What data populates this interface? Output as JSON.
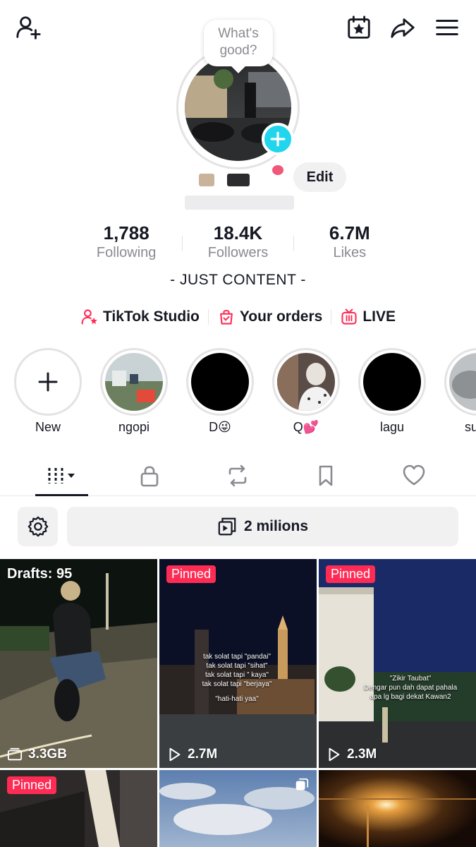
{
  "topbar": {
    "add_friend_icon": "person-plus-icon",
    "calendar_icon": "calendar-star-icon",
    "share_icon": "share-arrow-icon",
    "menu_icon": "hamburger-menu-icon"
  },
  "profile": {
    "bubble_line1": "What's",
    "bubble_line2": "good?",
    "edit_label": "Edit",
    "bio": "- JUST CONTENT -"
  },
  "stats": [
    {
      "value": "1,788",
      "label": "Following"
    },
    {
      "value": "18.4K",
      "label": "Followers"
    },
    {
      "value": "6.7M",
      "label": "Likes"
    }
  ],
  "links": [
    {
      "label": "TikTok Studio",
      "icon": "creator-star-icon"
    },
    {
      "label": "Your orders",
      "icon": "shopping-bag-icon"
    },
    {
      "label": "LIVE",
      "icon": "live-tv-icon"
    }
  ],
  "highlights": [
    {
      "label": "New"
    },
    {
      "label": "ngopi"
    },
    {
      "label": "D😜"
    },
    {
      "label": "Q💕"
    },
    {
      "label": "lagu"
    },
    {
      "label": "suns"
    }
  ],
  "tabs": [
    "videos-grid",
    "private-lock",
    "reposts",
    "favorites",
    "liked"
  ],
  "toolbar": {
    "collection_label": "2 milions"
  },
  "grid": [
    {
      "top_label": "Drafts: 95",
      "foot": "3.3GB"
    },
    {
      "badge": "Pinned",
      "foot": "2.7M",
      "lines": [
        "tak solat tapi \"pandai\"",
        "tak solat tapi \"sihat\"",
        "tak solat tapi \" kaya\"",
        "tak solat tapi \"berjaya\"",
        "",
        "\"hati-hati yaa\""
      ]
    },
    {
      "badge": "Pinned",
      "foot": "2.3M",
      "lines": [
        "\"Zikir Taubat\"",
        "Dengar pun dah dapat pahala",
        "apa lg bagi dekat Kawan2"
      ]
    },
    {
      "badge": "Pinned"
    },
    {},
    {}
  ],
  "colors": {
    "accent_pink": "#fe2c55",
    "accent_cyan": "#20d5ec",
    "text_primary": "#161823",
    "text_secondary": "#8a8b91"
  }
}
